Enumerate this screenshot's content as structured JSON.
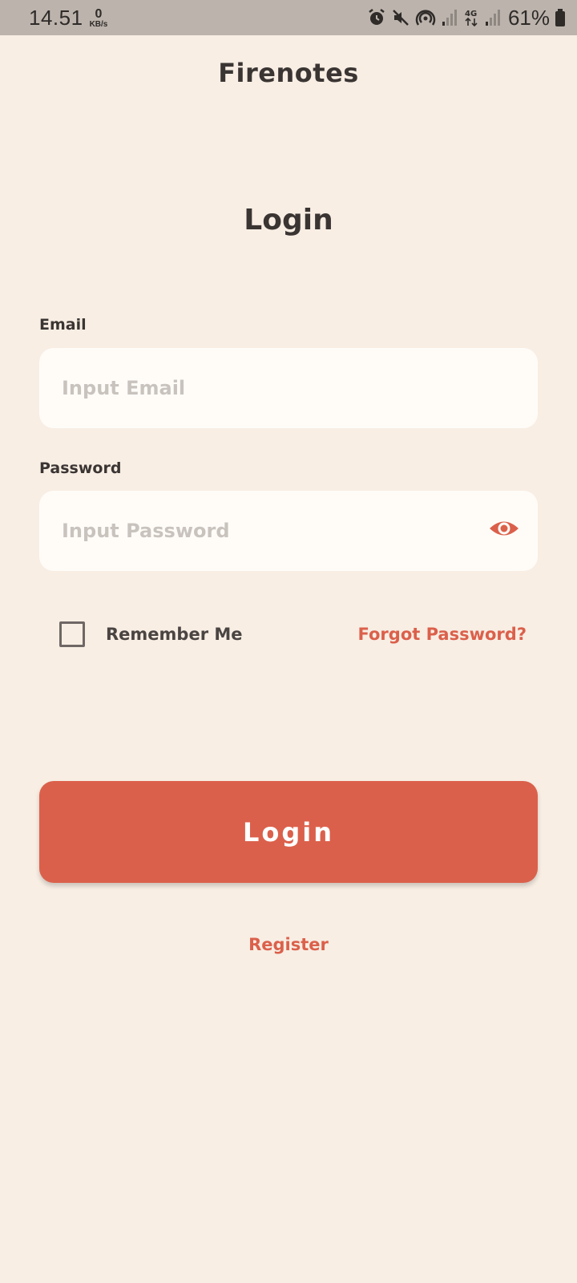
{
  "status_bar": {
    "time": "14.51",
    "net_speed_value": "0",
    "net_speed_unit": "KB/s",
    "battery_percent": "61%",
    "icons": [
      "alarm-icon",
      "mute-icon",
      "hotspot-icon",
      "signal-icon",
      "4g-icon",
      "signal-icon",
      "battery-icon"
    ]
  },
  "app": {
    "title": "Firenotes"
  },
  "page": {
    "title": "Login"
  },
  "form": {
    "email_label": "Email",
    "email_placeholder": "Input Email",
    "email_value": "",
    "password_label": "Password",
    "password_placeholder": "Input Password",
    "password_value": "",
    "remember_label": "Remember Me",
    "remember_checked": false,
    "forgot_label": "Forgot Password?",
    "login_label": "Login",
    "register_label": "Register"
  },
  "colors": {
    "background": "#F8EEE4",
    "accent": "#DB604B",
    "input_bg": "#FFFCF8",
    "text": "#3A3533"
  }
}
